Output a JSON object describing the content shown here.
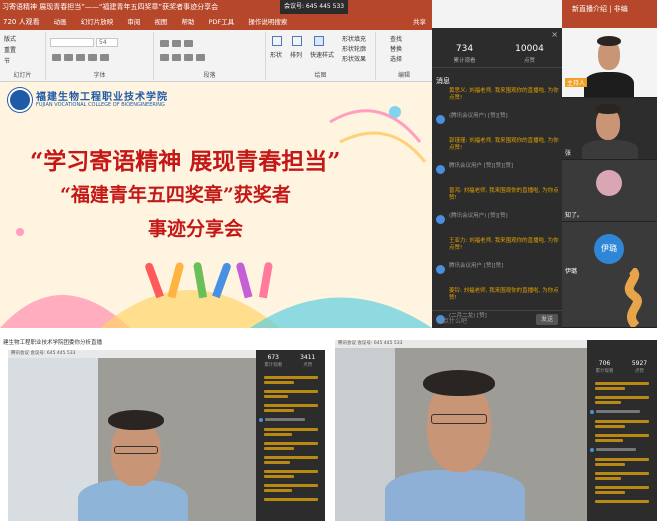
{
  "main": {
    "title_text": "习寄语精神 展现青春担当”——“福建青年五四奖章”获奖者事迹分享会",
    "meeting_id": "会议号: 645 445 533",
    "tabs": {
      "viewers": "720 人观看",
      "items": [
        "动画",
        "幻灯片放映",
        "审阅",
        "视图",
        "帮助",
        "PDF工具",
        "操作说明搜索"
      ],
      "share": "共享"
    },
    "ribbon": {
      "groups": [
        "幻灯片",
        "字体",
        "段落",
        "绘图",
        "编辑"
      ],
      "slide_cmds": [
        "版式",
        "重置",
        "节"
      ],
      "font_size": "54",
      "drawing_cmds": [
        "形状",
        "排列",
        "快速样式"
      ],
      "shape_opts": [
        "形状填充",
        "形状轮廓",
        "形状效果"
      ],
      "edit_cmds": [
        "查找",
        "替换",
        "选择"
      ]
    },
    "slide": {
      "school_cn": "福建生物工程职业技术学院",
      "school_en": "FUJIAN VOCATIONAL COLLEGE OF BIOENGINEERING",
      "line1": "“学习寄语精神 展现青春担当”",
      "line2": "“福建青年五四奖章”获奖者",
      "line3": "事迹分享会"
    },
    "chat": {
      "close": "×",
      "stat1_value": "734",
      "stat1_label": "累计观看",
      "stat2_value": "10004",
      "stat2_label": "点赞",
      "title": "消息",
      "messages": [
        {
          "text": "黄思义: 刘福老师, 我来围观你的直播啦, 为你点赞!",
          "highlight": true
        },
        {
          "text": "(腾讯会议用户) [赞][赞]",
          "highlight": false
        },
        {
          "text": "郭瑾瑾: 刘福老师, 我来围观你的直播啦, 为你点赞!",
          "highlight": true
        },
        {
          "text": "腾讯会议用户 [赞][赞][赞]",
          "highlight": false
        },
        {
          "text": "曾鸿: 刘福老师, 我来围观你的直播啦, 为你点赞!",
          "highlight": true
        },
        {
          "text": "(腾讯会议用户) [赞][赞]",
          "highlight": false
        },
        {
          "text": "王亚力: 刘福老师, 我来围观你的直播啦, 为你点赞!",
          "highlight": true
        },
        {
          "text": "腾讯会议用户 [赞][赞]",
          "highlight": false
        },
        {
          "text": "姜铃: 刘福老师, 我来围观你的直播啦, 为你点赞!",
          "highlight": true
        },
        {
          "text": "(二月二龙) [赞]",
          "highlight": false
        }
      ],
      "input_placeholder": "说点什么吧",
      "send": "发送"
    },
    "right": {
      "share_text": "新直播介绍 | 非编",
      "login": "",
      "tiles": [
        {
          "caption": "主持人"
        },
        {
          "caption": "张"
        },
        {
          "caption": "知了。"
        },
        {
          "caption": "伊璐"
        }
      ],
      "avatar_text": "伊璐"
    }
  },
  "bottom_left": {
    "title": "建生物工程职业技术学院团委你分析直播",
    "meeting_line": "腾讯会议 会议号: 645 445 533",
    "stat1": "673",
    "stat1_label": "累计观看",
    "stat2": "3411",
    "stat2_label": "点赞"
  },
  "bottom_right": {
    "meeting_line": "腾讯会议 会议号: 645 445 533",
    "stat1": "706",
    "stat1_label": "累计观看",
    "stat2": "5927",
    "stat2_label": "点赞"
  }
}
